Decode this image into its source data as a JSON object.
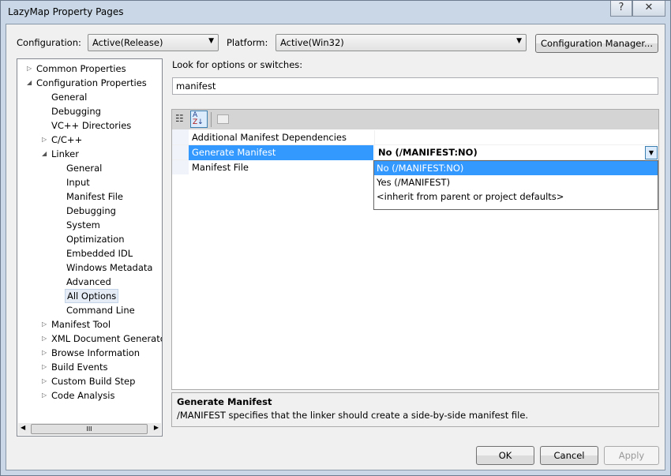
{
  "window": {
    "title": "LazyMap Property Pages",
    "help_label": "?",
    "close_label": "✕"
  },
  "config": {
    "configuration_label": "Configuration:",
    "configuration_value": "Active(Release)",
    "platform_label": "Platform:",
    "platform_value": "Active(Win32)",
    "manager_label": "Configuration Manager..."
  },
  "tree": {
    "items": [
      {
        "label": "Common Properties",
        "level": 0,
        "expander": "collapsed"
      },
      {
        "label": "Configuration Properties",
        "level": 0,
        "expander": "expanded"
      },
      {
        "label": "General",
        "level": 1
      },
      {
        "label": "Debugging",
        "level": 1
      },
      {
        "label": "VC++ Directories",
        "level": 1
      },
      {
        "label": "C/C++",
        "level": 1,
        "expander": "collapsed"
      },
      {
        "label": "Linker",
        "level": 1,
        "expander": "expanded"
      },
      {
        "label": "General",
        "level": 2
      },
      {
        "label": "Input",
        "level": 2
      },
      {
        "label": "Manifest File",
        "level": 2
      },
      {
        "label": "Debugging",
        "level": 2
      },
      {
        "label": "System",
        "level": 2
      },
      {
        "label": "Optimization",
        "level": 2
      },
      {
        "label": "Embedded IDL",
        "level": 2
      },
      {
        "label": "Windows Metadata",
        "level": 2
      },
      {
        "label": "Advanced",
        "level": 2
      },
      {
        "label": "All Options",
        "level": 2,
        "selected": true
      },
      {
        "label": "Command Line",
        "level": 2
      },
      {
        "label": "Manifest Tool",
        "level": 1,
        "expander": "collapsed"
      },
      {
        "label": "XML Document Generator",
        "level": 1,
        "expander": "collapsed"
      },
      {
        "label": "Browse Information",
        "level": 1,
        "expander": "collapsed"
      },
      {
        "label": "Build Events",
        "level": 1,
        "expander": "collapsed"
      },
      {
        "label": "Custom Build Step",
        "level": 1,
        "expander": "collapsed"
      },
      {
        "label": "Code Analysis",
        "level": 1,
        "expander": "collapsed"
      }
    ],
    "scroll_thumb": "III"
  },
  "search": {
    "label": "Look for options or switches:",
    "value": "manifest"
  },
  "grid": {
    "rows": [
      {
        "name": "Additional Manifest Dependencies",
        "value": ""
      },
      {
        "name": "Generate Manifest",
        "value": "No (/MANIFEST:NO)",
        "selected": true
      },
      {
        "name": "Manifest File",
        "value": ""
      }
    ],
    "dropdown_options": [
      "No (/MANIFEST:NO)",
      "Yes (/MANIFEST)",
      "<inherit from parent or project defaults>"
    ],
    "dropdown_selected": 0
  },
  "description": {
    "title": "Generate Manifest",
    "text": "/MANIFEST specifies that the linker should create a side-by-side manifest file."
  },
  "buttons": {
    "ok": "OK",
    "cancel": "Cancel",
    "apply": "Apply"
  },
  "colors": {
    "selection": "#3399ff"
  }
}
